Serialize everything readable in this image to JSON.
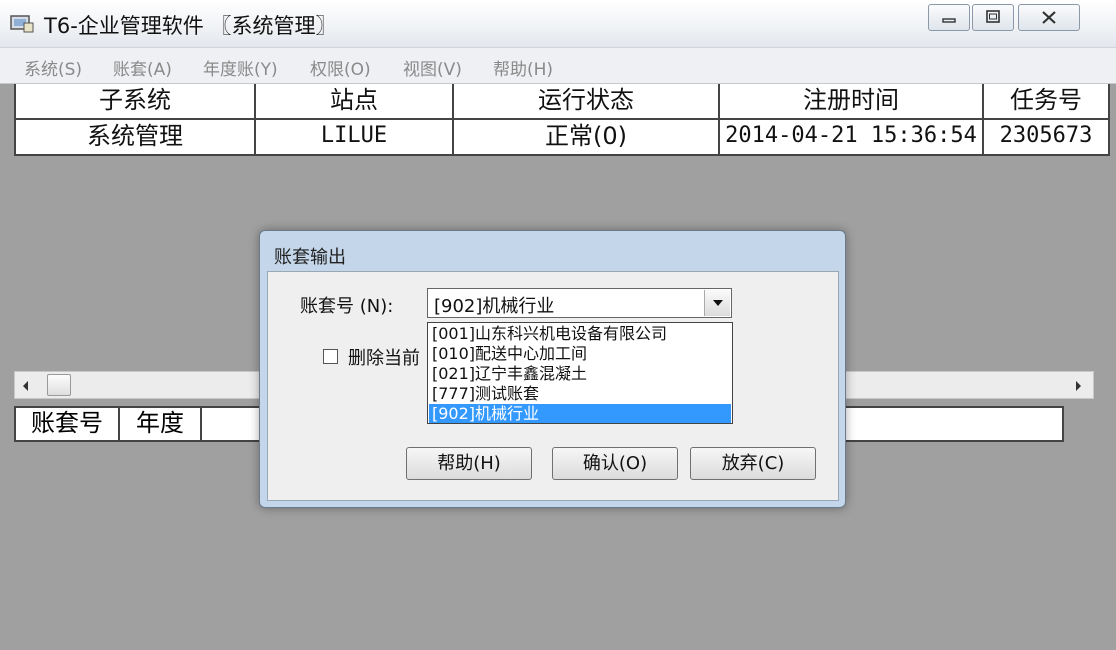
{
  "window": {
    "title": "T6-企业管理软件 〖系统管理〗"
  },
  "menu": [
    "系统(S)",
    "账套(A)",
    "年度账(Y)",
    "权限(O)",
    "视图(V)",
    "帮助(H)"
  ],
  "upper_grid": {
    "headers": [
      "子系统",
      "站点",
      "运行状态",
      "注册时间",
      "任务号"
    ],
    "row": [
      "系统管理",
      "LILUE",
      "正常(0)",
      "2014-04-21 15:36:54",
      "2305673"
    ]
  },
  "lower_grid": {
    "headers": [
      "账套号",
      "年度"
    ]
  },
  "dialog": {
    "title": "账套输出",
    "account_label": "账套号 (N):",
    "account_value": "[902]机械行业",
    "options": [
      "[001]山东科兴机电设备有限公司",
      "[010]配送中心加工间",
      "[021]辽宁丰鑫混凝土",
      "[777]测试账套",
      "[902]机械行业"
    ],
    "selected_index": 4,
    "delete_label": "删除当前",
    "buttons": {
      "help": "帮助(H)",
      "ok": "确认(O)",
      "cancel": "放弃(C)"
    }
  }
}
